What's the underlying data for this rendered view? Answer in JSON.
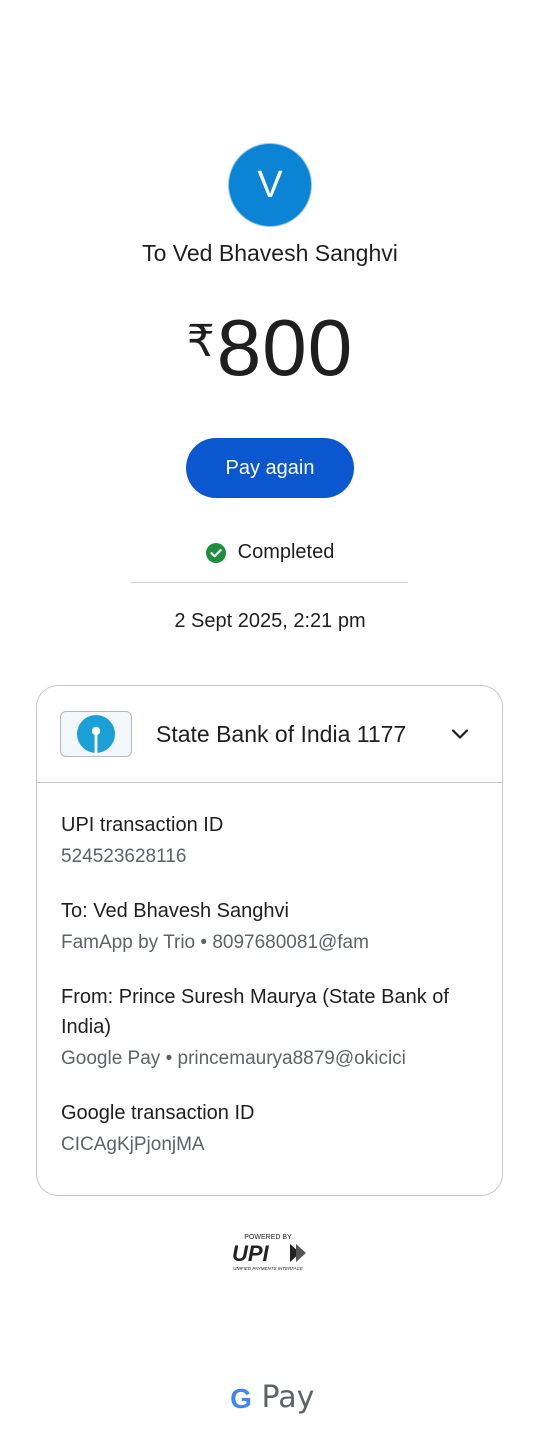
{
  "avatar": {
    "initial": "V",
    "color": "#0b84d6"
  },
  "recipient": "To Ved Bhavesh Sanghvi",
  "amount": {
    "currency": "₹",
    "value": "800"
  },
  "pay_again_label": "Pay again",
  "status": {
    "text": "Completed",
    "color": "#1e8e3e"
  },
  "datetime": "2 Sept 2025, 2:21 pm",
  "card": {
    "bank_name": "State Bank of India 1177",
    "upi_label": "UPI transaction ID",
    "upi_value": "524523628116",
    "to_label": "To: Ved Bhavesh Sanghvi",
    "to_value": "FamApp by Trio • 8097680081@fam",
    "from_label": "From: Prince Suresh Maurya (State Bank of India)",
    "from_value": "Google Pay • princemaurya8879@okicici",
    "google_label": "Google transaction ID",
    "google_value": "CICAgKjPjonjMA"
  },
  "footer": {
    "upi_powered": "POWERED BY",
    "upi_mark": "UPI",
    "upi_tagline": "UNIFIED PAYMENTS INTERFACE",
    "gpay_letter": "G",
    "gpay_text": "Pay"
  },
  "colors": {
    "accent": "#0b57d0"
  }
}
